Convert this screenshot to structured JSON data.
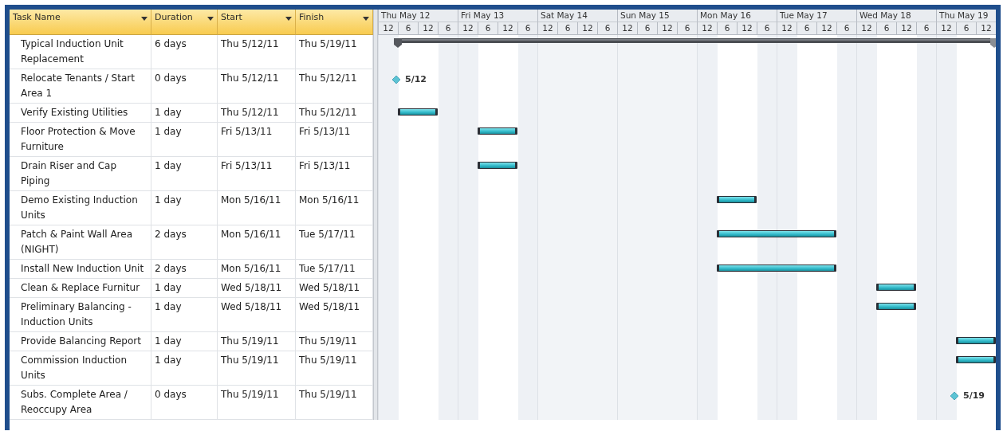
{
  "columns": [
    {
      "label": "Task Name"
    },
    {
      "label": "Duration"
    },
    {
      "label": "Start"
    },
    {
      "label": "Finish"
    }
  ],
  "timeline": {
    "days": [
      {
        "label": "Thu May 12",
        "nonworking": false,
        "ticks": [
          "12",
          "6",
          "12",
          "6"
        ]
      },
      {
        "label": "Fri May 13",
        "nonworking": false,
        "ticks": [
          "12",
          "6",
          "12",
          "6"
        ]
      },
      {
        "label": "Sat May 14",
        "nonworking": true,
        "ticks": [
          "12",
          "6",
          "12",
          "6"
        ]
      },
      {
        "label": "Sun May 15",
        "nonworking": true,
        "ticks": [
          "12",
          "6",
          "12",
          "6"
        ]
      },
      {
        "label": "Mon May 16",
        "nonworking": false,
        "ticks": [
          "12",
          "6",
          "12",
          "6"
        ]
      },
      {
        "label": "Tue May 17",
        "nonworking": false,
        "ticks": [
          "12",
          "6",
          "12",
          "6"
        ]
      },
      {
        "label": "Wed May 18",
        "nonworking": false,
        "ticks": [
          "12",
          "6",
          "12",
          "6"
        ]
      },
      {
        "label": "Thu May 19",
        "nonworking": false,
        "ticks": [
          "12",
          "6",
          "12"
        ]
      }
    ]
  },
  "tasks": [
    {
      "kind": "summary",
      "name": "Typical Induction Unit Replacement",
      "duration": "6 days",
      "start": "Thu 5/12/11",
      "finish": "Thu 5/19/11"
    },
    {
      "kind": "milestone",
      "name": "Relocate Tenants / Start Area 1",
      "duration": "0 days",
      "start": "Thu 5/12/11",
      "finish": "Thu 5/12/11",
      "milestone_label": "5/12"
    },
    {
      "kind": "task",
      "name": "Verify Existing Utilities",
      "duration": "1 day",
      "start": "Thu 5/12/11",
      "finish": "Thu 5/12/11"
    },
    {
      "kind": "task",
      "name": "Floor Protection & Move Furniture",
      "duration": "1 day",
      "start": "Fri 5/13/11",
      "finish": "Fri 5/13/11"
    },
    {
      "kind": "task",
      "name": "Drain Riser and Cap Piping",
      "duration": "1 day",
      "start": "Fri 5/13/11",
      "finish": "Fri 5/13/11"
    },
    {
      "kind": "task",
      "name": "Demo Existing Induction Units",
      "duration": "1 day",
      "start": "Mon 5/16/11",
      "finish": "Mon 5/16/11"
    },
    {
      "kind": "task",
      "name": "Patch & Paint Wall Area (NIGHT)",
      "duration": "2 days",
      "start": "Mon 5/16/11",
      "finish": "Tue 5/17/11"
    },
    {
      "kind": "task",
      "name": "Install New Induction Unit",
      "duration": "2 days",
      "start": "Mon 5/16/11",
      "finish": "Tue 5/17/11"
    },
    {
      "kind": "task",
      "name": "Clean & Replace Furnitur",
      "duration": "1 day",
      "start": "Wed 5/18/11",
      "finish": "Wed 5/18/11"
    },
    {
      "kind": "task",
      "name": "Preliminary Balancing - Induction Units",
      "duration": "1 day",
      "start": "Wed 5/18/11",
      "finish": "Wed 5/18/11"
    },
    {
      "kind": "task",
      "name": "Provide Balancing Report",
      "duration": "1 day",
      "start": "Thu 5/19/11",
      "finish": "Thu 5/19/11"
    },
    {
      "kind": "task",
      "name": "Commission Induction Units",
      "duration": "1 day",
      "start": "Thu 5/19/11",
      "finish": "Thu 5/19/11"
    },
    {
      "kind": "milestone",
      "name": "Subs. Complete Area / Reoccupy Area",
      "duration": "0 days",
      "start": "Thu 5/19/11",
      "finish": "Thu 5/19/11",
      "milestone_label": "5/19"
    }
  ]
}
